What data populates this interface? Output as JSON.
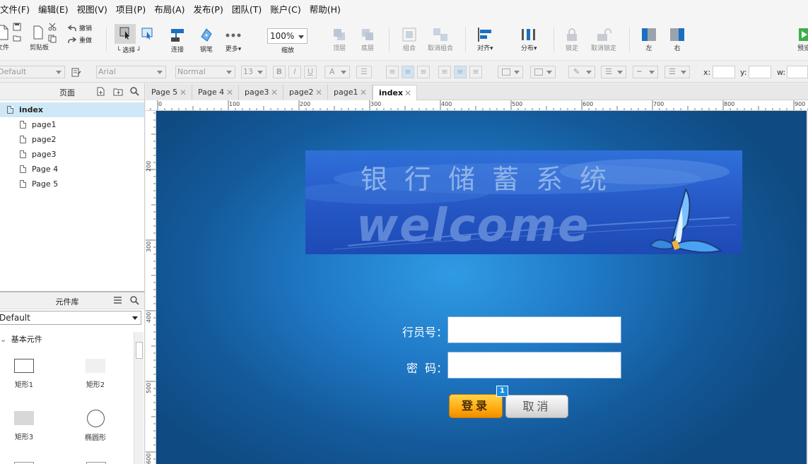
{
  "menu": [
    "文件(F)",
    "编辑(E)",
    "视图(V)",
    "项目(P)",
    "布局(A)",
    "发布(P)",
    "团队(T)",
    "账户(C)",
    "帮助(H)"
  ],
  "toolbar": {
    "file": "文件",
    "clipboard": "剪贴板",
    "undo": "撤销",
    "redo": "重做",
    "select": "选择",
    "connect": "连接",
    "pen": "钢笔",
    "more": "更多▾",
    "zoom_value": "100%",
    "zoom": "缩放",
    "top": "顶层",
    "bottom": "底层",
    "group": "组合",
    "ungroup": "取消组合",
    "align": "对齐▾",
    "distribute": "分布▾",
    "lock": "锁定",
    "unlock": "取消锁定",
    "left": "左",
    "right": "右",
    "preview": "预览"
  },
  "format": {
    "style": "Default",
    "font": "Arial",
    "weight": "Normal",
    "size": "13",
    "bold": "B",
    "italic": "I",
    "underline": "U",
    "font_color": "A",
    "x_label": "x:",
    "y_label": "y:",
    "w_label": "w:"
  },
  "pages_panel": {
    "title": "页面",
    "items": [
      "index",
      "page1",
      "page2",
      "page3",
      "Page 4",
      "Page 5"
    ]
  },
  "library_panel": {
    "title": "元件库",
    "selected": "Default",
    "section": "基本元件",
    "widgets": [
      "矩形1",
      "矩形2",
      "矩形3",
      "椭圆形"
    ]
  },
  "tabs": [
    "Page 5",
    "Page 4",
    "page3",
    "page2",
    "page1",
    "index"
  ],
  "ruler": {
    "top": [
      "0",
      "100",
      "200",
      "300",
      "400",
      "500",
      "600",
      "700",
      "800",
      "900"
    ],
    "left": [
      "200",
      "300",
      "400",
      "500",
      "600"
    ]
  },
  "canvas": {
    "banner_title": "银行储蓄系统",
    "banner_welcome": "welcome",
    "teller_label": "行员号：",
    "password_label": "密  码：",
    "login_button": "登录",
    "cancel_button": "取消",
    "badge": "1"
  },
  "colors": {
    "accent": "#1a8ee0",
    "login_orange": "#ffab10",
    "canvas_blue": "#1f77c4"
  }
}
